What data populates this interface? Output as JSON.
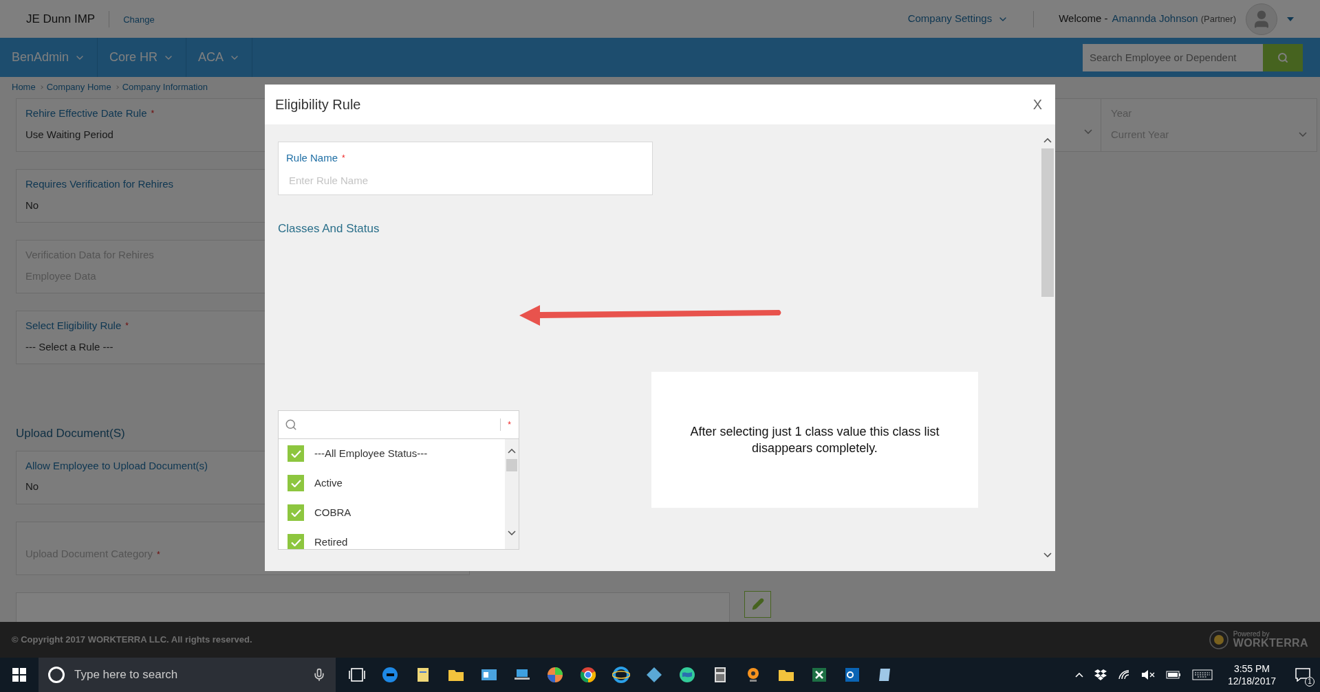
{
  "header": {
    "company": "JE Dunn IMP",
    "change_link": "Change",
    "settings": "Company Settings",
    "welcome": "Welcome -",
    "user": "Amannda Johnson",
    "role": "(Partner)"
  },
  "nav": [
    {
      "label": "BenAdmin"
    },
    {
      "label": "Core HR"
    },
    {
      "label": "ACA"
    }
  ],
  "search": {
    "placeholder": "Search Employee or Dependent"
  },
  "breadcrumb": [
    "Home",
    "Company Home",
    "Company Information"
  ],
  "left_column": [
    {
      "kind": "field",
      "label": "Rehire Effective Date Rule",
      "marker": "*",
      "value": "Use Waiting Period",
      "disabled": false
    },
    {
      "kind": "field",
      "label": "Requires Verification for Rehires",
      "value": "No",
      "disabled": false
    },
    {
      "kind": "field",
      "label": "Verification Data for Rehires",
      "value": "Employee Data",
      "disabled": true
    },
    {
      "kind": "field",
      "label": "Select Eligibility Rule",
      "marker": "*",
      "value": "--- Select a Rule ---",
      "disabled": false
    },
    {
      "kind": "heading",
      "label": "Upload Document(S)"
    },
    {
      "kind": "field",
      "label": "Allow Employee to Upload Document(s)",
      "value": "No",
      "disabled": false
    },
    {
      "kind": "field",
      "label": "Upload Document Category",
      "marker": "*",
      "disabled": true
    }
  ],
  "year_field": {
    "label": "Year",
    "value": "Current Year",
    "disabled": true
  },
  "modal": {
    "title": "Eligibility Rule",
    "close": "X",
    "rule_name": {
      "label": "Rule Name",
      "marker": "*",
      "placeholder": "Enter Rule Name"
    },
    "section": "Classes And Status",
    "classes": {
      "marker": "*",
      "options": [
        {
          "label": "---All Employee Status---",
          "checked": true
        },
        {
          "label": "Active",
          "checked": true
        },
        {
          "label": "COBRA",
          "checked": true
        },
        {
          "label": "Retired",
          "checked": true
        }
      ]
    },
    "note": "After selecting just 1 class value this class list disappears completely."
  },
  "footer": {
    "copyright": "© Copyright 2017 WORKTERRA LLC. All rights reserved.",
    "powered_by": "Powered by",
    "brand": "WORKTERRA"
  },
  "taskbar": {
    "search_placeholder": "Type here to search",
    "time": "3:55 PM",
    "date": "12/18/2017",
    "notifications": "1"
  }
}
